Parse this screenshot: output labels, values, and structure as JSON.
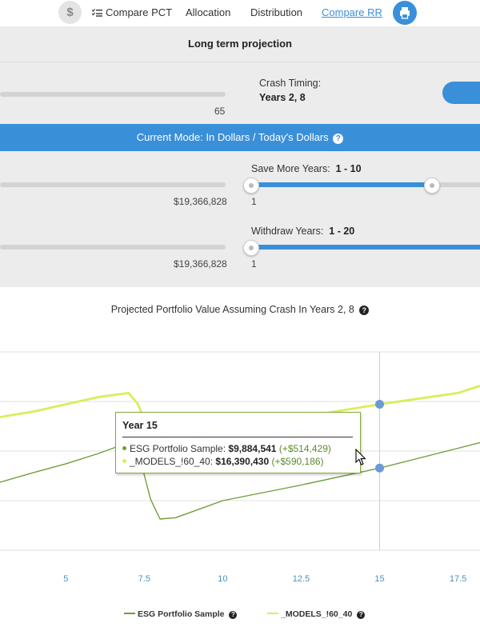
{
  "toolbar": {
    "dollar_icon": "dollar-icon",
    "compare_pct": "Compare PCT",
    "allocation": "Allocation",
    "distribution": "Distribution",
    "compare_rr": "Compare RR",
    "print_icon": "print-icon"
  },
  "settings": {
    "title": "Long term projection",
    "age_value": "65",
    "crash_timing_label": "Crash Timing:",
    "crash_timing_value": "Years 2, 8",
    "mode_text": "Current Mode: In Dollars / Today's Dollars",
    "save_label": "Save More Years:",
    "save_range": "1 - 10",
    "save_min": "1",
    "save_amount": "$19,366,828",
    "withdraw_label": "Withdraw Years:",
    "withdraw_range": "1 - 20",
    "withdraw_min": "1",
    "withdraw_amount": "$19,366,828"
  },
  "chart": {
    "title": "Projected Portfolio Value Assuming Crash In Years 2, 8"
  },
  "tooltip": {
    "title": "Year 15",
    "row1_name": "ESG Portfolio Sample:",
    "row1_value": "$9,884,541",
    "row1_change": "(+$514,429)",
    "row2_name": "_MODELS_!60_40:",
    "row2_value": "$16,390,430",
    "row2_change": "(+$590,186)"
  },
  "colors": {
    "accent": "#3a8fd9",
    "series1": "#6f9e3a",
    "series2": "#d9ee5a"
  },
  "chart_data": {
    "type": "line",
    "title": "Projected Portfolio Value Assuming Crash In Years 2, 8",
    "xlabel": "",
    "ylabel": "",
    "xlim": [
      2.9,
      18.2
    ],
    "x_ticks": [
      "5",
      "7.5",
      "10",
      "12.5",
      "15",
      "17.5"
    ],
    "grid": true,
    "legend": "bottom",
    "series": [
      {
        "name": "ESG Portfolio Sample",
        "x": [
          2.9,
          4,
          5,
          6,
          7,
          7.3,
          7.7,
          8,
          8.5,
          10,
          12.5,
          15,
          17.5,
          18.2
        ],
        "y": [
          12.8,
          13.5,
          14.1,
          14.8,
          15.6,
          15.0,
          11.6,
          10.2,
          10.3,
          11.5,
          12.6,
          13.8,
          15.2,
          15.6
        ]
      },
      {
        "name": "_MODELS_!60_40",
        "x": [
          2.9,
          4,
          5,
          6,
          7,
          7.3,
          7.7,
          8,
          8.5,
          10,
          12.5,
          15,
          17.5,
          18.2
        ],
        "y": [
          17.4,
          17.8,
          18.3,
          18.8,
          19.1,
          18.3,
          16.2,
          16.0,
          16.1,
          16.6,
          17.4,
          18.3,
          19.1,
          19.6
        ]
      }
    ],
    "highlight": {
      "x": 15,
      "values": [
        13.8,
        18.3
      ]
    }
  }
}
